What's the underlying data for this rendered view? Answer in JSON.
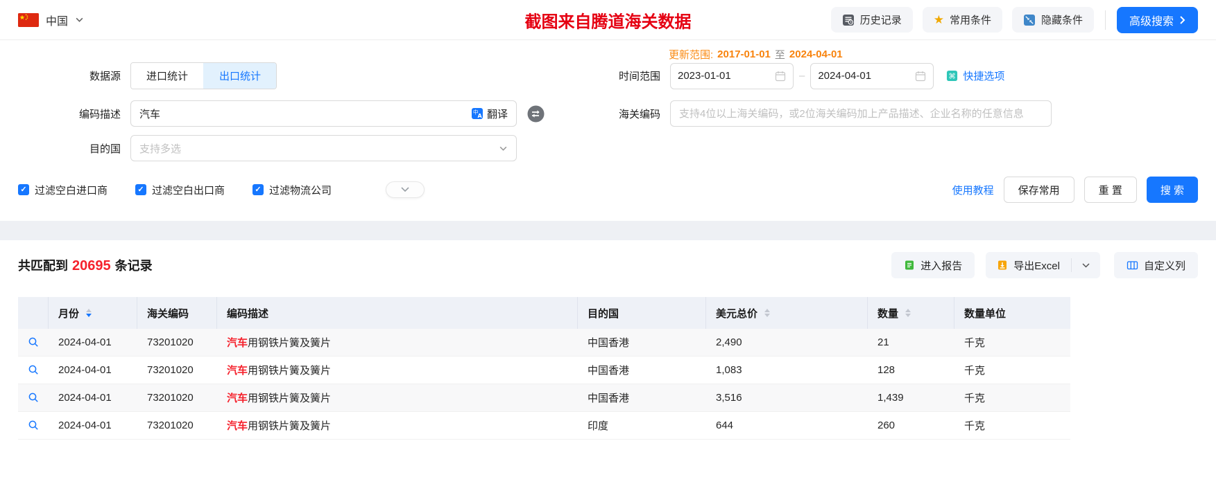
{
  "topbar": {
    "country": "中国",
    "banner_title": "截图来自腾道海关数据",
    "history_label": "历史记录",
    "favorites_label": "常用条件",
    "hide_label": "隐藏条件",
    "advanced_label": "高级搜索"
  },
  "filters": {
    "source_label": "数据源",
    "tab_import": "进口统计",
    "tab_export": "出口统计",
    "update_prefix": "更新范围:",
    "update_start": "2017-01-01",
    "update_to": "至",
    "update_end": "2024-04-01",
    "time_label": "时间范围",
    "time_start": "2023-01-01",
    "time_end": "2024-04-01",
    "quick_label": "快捷选项",
    "desc_label": "编码描述",
    "desc_value": "汽车",
    "translate_label": "翻译",
    "hs_label": "海关编码",
    "hs_placeholder": "支持4位以上海关编码，或2位海关编码加上产品描述、企业名称的任意信息",
    "dest_label": "目的国",
    "dest_placeholder": "支持多选",
    "checkbox_import": "过滤空白进口商",
    "checkbox_export": "过滤空白出口商",
    "checkbox_logistics": "过滤物流公司",
    "tutorial_label": "使用教程",
    "save_label": "保存常用",
    "reset_label": "重 置",
    "search_label": "搜 索"
  },
  "results": {
    "match_prefix": "共匹配到",
    "match_count": "20695",
    "match_suffix": "条记录",
    "report_label": "进入报告",
    "export_label": "导出Excel",
    "customize_label": "自定义列",
    "columns": [
      {
        "label": ""
      },
      {
        "label": "月份"
      },
      {
        "label": "海关编码"
      },
      {
        "label": "编码描述"
      },
      {
        "label": "目的国"
      },
      {
        "label": "美元总价"
      },
      {
        "label": "数量"
      },
      {
        "label": "数量单位"
      }
    ],
    "rows": [
      {
        "date": "2024-04-01",
        "code": "73201020",
        "desc_hl": "汽车",
        "desc_rest": "用钢铁片簧及簧片",
        "dest": "中国香港",
        "usd": "2,490",
        "qty": "21",
        "unit": "千克"
      },
      {
        "date": "2024-04-01",
        "code": "73201020",
        "desc_hl": "汽车",
        "desc_rest": "用钢铁片簧及簧片",
        "dest": "中国香港",
        "usd": "1,083",
        "qty": "128",
        "unit": "千克"
      },
      {
        "date": "2024-04-01",
        "code": "73201020",
        "desc_hl": "汽车",
        "desc_rest": "用钢铁片簧及簧片",
        "dest": "中国香港",
        "usd": "3,516",
        "qty": "1,439",
        "unit": "千克"
      },
      {
        "date": "2024-04-01",
        "code": "73201020",
        "desc_hl": "汽车",
        "desc_rest": "用钢铁片簧及簧片",
        "dest": "印度",
        "usd": "644",
        "qty": "260",
        "unit": "千克"
      }
    ]
  },
  "colors": {
    "accent": "#1677ff",
    "danger": "#f5222d",
    "update_orange": "#fa8c16",
    "tab_active_bg": "#e2f1fd",
    "table_header_bg": "#eef1f7"
  }
}
